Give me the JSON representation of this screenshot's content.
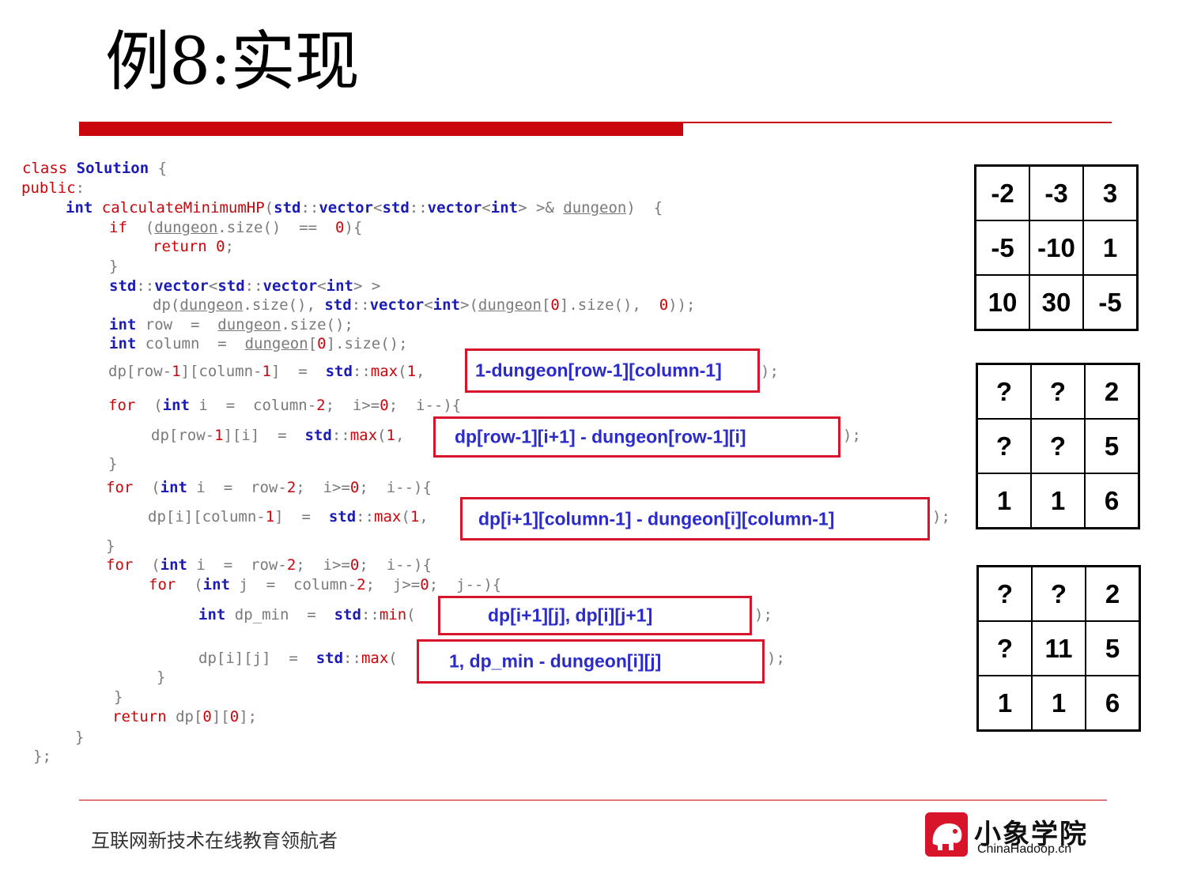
{
  "title": "例8:实现",
  "code": [
    {
      "parts": [
        {
          "c": "kw",
          "t": "class "
        },
        {
          "c": "ty",
          "t": "Solution"
        },
        {
          "c": "plain",
          "t": " {"
        }
      ]
    },
    {
      "parts": [
        {
          "c": "kw",
          "t": "public"
        },
        {
          "c": "plain",
          "t": ":"
        }
      ]
    },
    {
      "parts": [
        {
          "c": "ty",
          "t": "int"
        },
        {
          "c": "kw",
          "t": " calculateMinimumHP"
        },
        {
          "c": "plain",
          "t": "("
        },
        {
          "c": "ty",
          "t": "std"
        },
        {
          "c": "plain",
          "t": "::"
        },
        {
          "c": "ty",
          "t": "vector"
        },
        {
          "c": "plain",
          "t": "<"
        },
        {
          "c": "ty",
          "t": "std"
        },
        {
          "c": "plain",
          "t": "::"
        },
        {
          "c": "ty",
          "t": "vector"
        },
        {
          "c": "plain",
          "t": "<"
        },
        {
          "c": "ty",
          "t": "int"
        },
        {
          "c": "plain",
          "t": "> >& "
        },
        {
          "c": "arg",
          "t": "dungeon"
        },
        {
          "c": "plain",
          "t": ")  {"
        }
      ]
    },
    {
      "parts": [
        {
          "c": "kw",
          "t": "if"
        },
        {
          "c": "plain",
          "t": "  ("
        },
        {
          "c": "arg",
          "t": "dungeon"
        },
        {
          "c": "plain",
          "t": ".size()  ==  "
        },
        {
          "c": "num",
          "t": "0"
        },
        {
          "c": "plain",
          "t": "){"
        }
      ]
    },
    {
      "parts": [
        {
          "c": "kw",
          "t": "return"
        },
        {
          "c": "plain",
          "t": " "
        },
        {
          "c": "num",
          "t": "0"
        },
        {
          "c": "plain",
          "t": ";"
        }
      ]
    },
    {
      "parts": [
        {
          "c": "plain",
          "t": "}"
        }
      ]
    },
    {
      "parts": [
        {
          "c": "ty",
          "t": "std"
        },
        {
          "c": "plain",
          "t": "::"
        },
        {
          "c": "ty",
          "t": "vector"
        },
        {
          "c": "plain",
          "t": "<"
        },
        {
          "c": "ty",
          "t": "std"
        },
        {
          "c": "plain",
          "t": "::"
        },
        {
          "c": "ty",
          "t": "vector"
        },
        {
          "c": "plain",
          "t": "<"
        },
        {
          "c": "ty",
          "t": "int"
        },
        {
          "c": "plain",
          "t": "> >"
        }
      ]
    },
    {
      "parts": [
        {
          "c": "plain",
          "t": "dp("
        },
        {
          "c": "arg",
          "t": "dungeon"
        },
        {
          "c": "plain",
          "t": ".size(), "
        },
        {
          "c": "ty",
          "t": "std"
        },
        {
          "c": "plain",
          "t": "::"
        },
        {
          "c": "ty",
          "t": "vector"
        },
        {
          "c": "plain",
          "t": "<"
        },
        {
          "c": "ty",
          "t": "int"
        },
        {
          "c": "plain",
          "t": ">("
        },
        {
          "c": "arg",
          "t": "dungeon"
        },
        {
          "c": "plain",
          "t": "["
        },
        {
          "c": "num",
          "t": "0"
        },
        {
          "c": "plain",
          "t": "].size(),  "
        },
        {
          "c": "num",
          "t": "0"
        },
        {
          "c": "plain",
          "t": "));"
        }
      ]
    },
    {
      "parts": [
        {
          "c": "ty",
          "t": "int"
        },
        {
          "c": "plain",
          "t": " row  =  "
        },
        {
          "c": "arg",
          "t": "dungeon"
        },
        {
          "c": "plain",
          "t": ".size();"
        }
      ]
    },
    {
      "parts": [
        {
          "c": "ty",
          "t": "int"
        },
        {
          "c": "plain",
          "t": " column  =  "
        },
        {
          "c": "arg",
          "t": "dungeon"
        },
        {
          "c": "plain",
          "t": "["
        },
        {
          "c": "num",
          "t": "0"
        },
        {
          "c": "plain",
          "t": "].size();"
        }
      ]
    },
    {
      "parts": [
        {
          "c": "plain",
          "t": "dp[row-"
        },
        {
          "c": "num",
          "t": "1"
        },
        {
          "c": "plain",
          "t": "][column-"
        },
        {
          "c": "num",
          "t": "1"
        },
        {
          "c": "plain",
          "t": "]  =  "
        },
        {
          "c": "ty",
          "t": "std"
        },
        {
          "c": "plain",
          "t": "::"
        },
        {
          "c": "kw",
          "t": "max"
        },
        {
          "c": "plain",
          "t": "("
        },
        {
          "c": "num",
          "t": "1"
        },
        {
          "c": "plain",
          "t": ","
        }
      ]
    },
    {
      "parts": [
        {
          "c": "kw",
          "t": "for"
        },
        {
          "c": "plain",
          "t": "  ("
        },
        {
          "c": "ty",
          "t": "int"
        },
        {
          "c": "plain",
          "t": " i  =  column-"
        },
        {
          "c": "num",
          "t": "2"
        },
        {
          "c": "plain",
          "t": ";  i>="
        },
        {
          "c": "num",
          "t": "0"
        },
        {
          "c": "plain",
          "t": ";  i--){"
        }
      ]
    },
    {
      "parts": [
        {
          "c": "plain",
          "t": "dp[row-"
        },
        {
          "c": "num",
          "t": "1"
        },
        {
          "c": "plain",
          "t": "][i]  =  "
        },
        {
          "c": "ty",
          "t": "std"
        },
        {
          "c": "plain",
          "t": "::"
        },
        {
          "c": "kw",
          "t": "max"
        },
        {
          "c": "plain",
          "t": "("
        },
        {
          "c": "num",
          "t": "1"
        },
        {
          "c": "plain",
          "t": ","
        }
      ]
    },
    {
      "parts": [
        {
          "c": "plain",
          "t": "}"
        }
      ]
    },
    {
      "parts": [
        {
          "c": "kw",
          "t": "for"
        },
        {
          "c": "plain",
          "t": "  ("
        },
        {
          "c": "ty",
          "t": "int"
        },
        {
          "c": "plain",
          "t": " i  =  row-"
        },
        {
          "c": "num",
          "t": "2"
        },
        {
          "c": "plain",
          "t": ";  i>="
        },
        {
          "c": "num",
          "t": "0"
        },
        {
          "c": "plain",
          "t": ";  i--){"
        }
      ]
    },
    {
      "parts": [
        {
          "c": "plain",
          "t": "dp[i][column-"
        },
        {
          "c": "num",
          "t": "1"
        },
        {
          "c": "plain",
          "t": "]  =  "
        },
        {
          "c": "ty",
          "t": "std"
        },
        {
          "c": "plain",
          "t": "::"
        },
        {
          "c": "kw",
          "t": "max"
        },
        {
          "c": "plain",
          "t": "("
        },
        {
          "c": "num",
          "t": "1"
        },
        {
          "c": "plain",
          "t": ","
        }
      ]
    },
    {
      "parts": [
        {
          "c": "plain",
          "t": "}"
        }
      ]
    },
    {
      "parts": [
        {
          "c": "kw",
          "t": "for"
        },
        {
          "c": "plain",
          "t": "  ("
        },
        {
          "c": "ty",
          "t": "int"
        },
        {
          "c": "plain",
          "t": " i  =  row-"
        },
        {
          "c": "num",
          "t": "2"
        },
        {
          "c": "plain",
          "t": ";  i>="
        },
        {
          "c": "num",
          "t": "0"
        },
        {
          "c": "plain",
          "t": ";  i--){"
        }
      ]
    },
    {
      "parts": [
        {
          "c": "kw",
          "t": "for"
        },
        {
          "c": "plain",
          "t": "  ("
        },
        {
          "c": "ty",
          "t": "int"
        },
        {
          "c": "plain",
          "t": " j  =  column-"
        },
        {
          "c": "num",
          "t": "2"
        },
        {
          "c": "plain",
          "t": ";  j>="
        },
        {
          "c": "num",
          "t": "0"
        },
        {
          "c": "plain",
          "t": ";  j--){"
        }
      ]
    },
    {
      "parts": [
        {
          "c": "ty",
          "t": "int"
        },
        {
          "c": "plain",
          "t": " dp_min  =  "
        },
        {
          "c": "ty",
          "t": "std"
        },
        {
          "c": "plain",
          "t": "::"
        },
        {
          "c": "kw",
          "t": "min"
        },
        {
          "c": "plain",
          "t": "("
        }
      ]
    },
    {
      "parts": [
        {
          "c": "plain",
          "t": "dp[i][j]  =  "
        },
        {
          "c": "ty",
          "t": "std"
        },
        {
          "c": "plain",
          "t": "::"
        },
        {
          "c": "kw",
          "t": "max"
        },
        {
          "c": "plain",
          "t": "("
        }
      ]
    },
    {
      "parts": [
        {
          "c": "plain",
          "t": "}"
        }
      ]
    },
    {
      "parts": [
        {
          "c": "plain",
          "t": "}"
        }
      ]
    },
    {
      "parts": [
        {
          "c": "kw",
          "t": "return"
        },
        {
          "c": "plain",
          "t": " dp["
        },
        {
          "c": "num",
          "t": "0"
        },
        {
          "c": "plain",
          "t": "]["
        },
        {
          "c": "num",
          "t": "0"
        },
        {
          "c": "plain",
          "t": "];"
        }
      ]
    },
    {
      "parts": [
        {
          "c": "plain",
          "t": "}"
        }
      ]
    },
    {
      "parts": [
        {
          "c": "plain",
          "t": "};"
        }
      ]
    }
  ],
  "tails": [
    {
      "text": ");"
    },
    {
      "text": ");"
    },
    {
      "text": ");"
    },
    {
      "text": ");"
    },
    {
      "text": ");"
    }
  ],
  "highlights": [
    {
      "text": "1-dungeon[row-1][column-1]"
    },
    {
      "text": "dp[row-1][i+1] - dungeon[row-1][i]"
    },
    {
      "text": "dp[i+1][column-1] - dungeon[i][column-1]"
    },
    {
      "text": "dp[i+1][j], dp[i][j+1]"
    },
    {
      "text": "1, dp_min - dungeon[i][j]"
    }
  ],
  "grids": [
    [
      [
        "-2",
        "-3",
        "3"
      ],
      [
        "-5",
        "-10",
        "1"
      ],
      [
        "10",
        "30",
        "-5"
      ]
    ],
    [
      [
        "?",
        "?",
        "2"
      ],
      [
        "?",
        "?",
        "5"
      ],
      [
        "1",
        "1",
        "6"
      ]
    ],
    [
      [
        "?",
        "?",
        "2"
      ],
      [
        "?",
        "11",
        "5"
      ],
      [
        "1",
        "1",
        "6"
      ]
    ]
  ],
  "footer": {
    "slogan": "互联网新技术在线教育领航者",
    "logo_cn": "小象学院",
    "logo_en": "ChinaHadoop.cn"
  },
  "colors": {
    "accent": "#c9060b",
    "highlight_border": "#d8142a",
    "highlight_text": "#2b2bcc"
  }
}
